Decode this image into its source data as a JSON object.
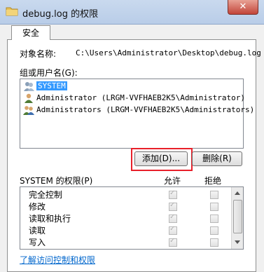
{
  "window": {
    "title": "debug.log 的权限",
    "close_label": "✕"
  },
  "tabs": [
    {
      "label": "安全"
    }
  ],
  "object": {
    "label": "对象名称:",
    "value": "C:\\Users\\Administrator\\Desktop\\debug.log"
  },
  "groups": {
    "label": "组或用户名(G):",
    "items": [
      {
        "name": "SYSTEM",
        "selected": true
      },
      {
        "name": "Administrator (LRGM-VVFHAEB2K5\\Administrator)",
        "selected": false
      },
      {
        "name": "Administrators (LRGM-VVFHAEB2K5\\Administrators)",
        "selected": false
      }
    ]
  },
  "buttons": {
    "add": "添加(D)...",
    "remove": "删除(R)"
  },
  "permissions": {
    "header_label": "SYSTEM 的权限(P)",
    "allow_label": "允许",
    "deny_label": "拒绝",
    "rows": [
      {
        "name": "完全控制",
        "allow": true,
        "deny": false
      },
      {
        "name": "修改",
        "allow": true,
        "deny": false
      },
      {
        "name": "读取和执行",
        "allow": true,
        "deny": false
      },
      {
        "name": "读取",
        "allow": true,
        "deny": false
      },
      {
        "name": "写入",
        "allow": true,
        "deny": false
      }
    ]
  },
  "link": "了解访问控制和权限"
}
